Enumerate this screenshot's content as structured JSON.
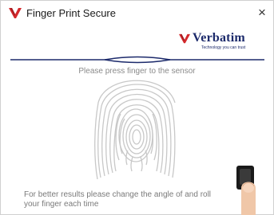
{
  "window": {
    "title": "Finger Print Secure",
    "close_symbol": "×",
    "app_icon": "verbatim-v-icon"
  },
  "brand": {
    "name": "Verbatim",
    "tagline": "Technology you can trust",
    "logo_icon": "verbatim-v-icon"
  },
  "instruction": "Please press finger to the sensor",
  "tip": {
    "line1": "For better results please change the angle of and roll",
    "line2": "your finger each time"
  },
  "colors": {
    "brand_red": "#d4282c",
    "brand_navy": "#1c2a6b",
    "fingerprint_gray": "#c8c8c8"
  },
  "illustration": {
    "fingerprint": "fingerprint-icon",
    "sensor": "finger-on-sensor-icon"
  }
}
